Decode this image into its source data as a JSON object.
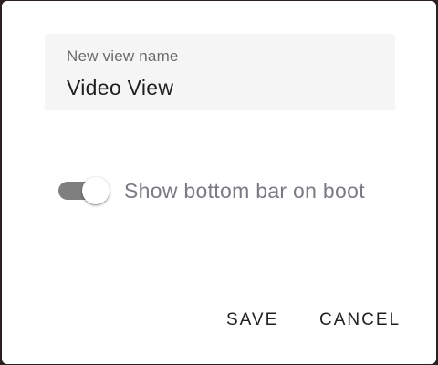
{
  "dialog": {
    "name_field": {
      "label": "New view name",
      "value": "Video View"
    },
    "toggle": {
      "label": "Show bottom bar on boot",
      "checked": true
    },
    "actions": {
      "save_label": "SAVE",
      "cancel_label": "CANCEL"
    }
  },
  "colors": {
    "dialog_background": "#ffffff",
    "field_background": "#f5f5f5",
    "toggle_track": "#7f7f7f",
    "toggle_label": "#7a7a82",
    "text_primary": "#1f1f1f"
  }
}
